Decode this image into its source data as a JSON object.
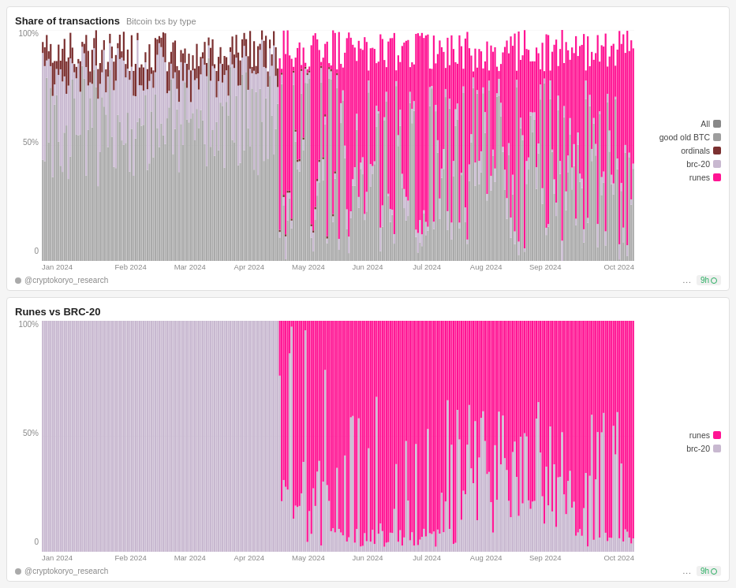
{
  "charts": [
    {
      "id": "chart1",
      "title": "Share of transactions",
      "subtitle": "Bitcoin txs by type",
      "y_labels": [
        "100%",
        "50%",
        "0"
      ],
      "x_labels": [
        "Jan 2024",
        "Feb 2024",
        "Mar 2024",
        "Apr 2024",
        "May 2024",
        "Jun 2024",
        "Jul 2024",
        "Aug 2024",
        "Sep 2024",
        "Oct 2024"
      ],
      "legend": [
        {
          "label": "All",
          "color": "#888888"
        },
        {
          "label": "good old BTC",
          "color": "#9e9e9e"
        },
        {
          "label": "ordinals",
          "color": "#7b3030"
        },
        {
          "label": "brc-20",
          "color": "#c8b8d0"
        },
        {
          "label": "runes",
          "color": "#ff1493"
        }
      ],
      "footer_user": "@cryptokoryo_research",
      "footer_time": "9h"
    },
    {
      "id": "chart2",
      "title": "Runes vs BRC-20",
      "subtitle": "",
      "y_labels": [
        "100%",
        "50%",
        "0"
      ],
      "x_labels": [
        "Jan 2024",
        "Feb 2024",
        "Mar 2024",
        "Apr 2024",
        "May 2024",
        "Jun 2024",
        "Jul 2024",
        "Aug 2024",
        "Sep 2024",
        "Oct 2024"
      ],
      "legend": [
        {
          "label": "runes",
          "color": "#ff1493"
        },
        {
          "label": "brc-20",
          "color": "#c8b8d0"
        }
      ],
      "footer_user": "@cryptokoryo_research",
      "footer_time": "9h"
    }
  ],
  "dots_label": "...",
  "time_suffix": "h"
}
